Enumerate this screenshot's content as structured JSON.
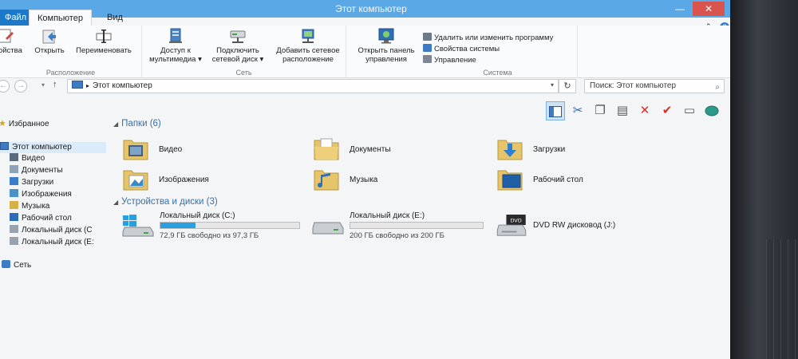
{
  "window": {
    "title": "Этот компьютер"
  },
  "tabs": {
    "file": "Файл",
    "computer": "Компьютер",
    "view": "Вид"
  },
  "ribbon": {
    "location": {
      "label": "Расположение",
      "properties": "Свойства",
      "open": "Открыть",
      "rename": "Переименовать"
    },
    "network": {
      "label": "Сеть",
      "media_access_l1": "Доступ к",
      "media_access_l2": "мультимедиа",
      "map_drive_l1": "Подключить",
      "map_drive_l2": "сетевой диск",
      "add_location_l1": "Добавить сетевое",
      "add_location_l2": "расположение"
    },
    "system": {
      "label": "Система",
      "control_panel_l1": "Открыть панель",
      "control_panel_l2": "управления",
      "uninstall": "Удалить или изменить программу",
      "sys_props": "Свойства системы",
      "manage": "Управление"
    }
  },
  "address": {
    "path": "Этот компьютер",
    "search_placeholder": "Поиск: Этот компьютер"
  },
  "nav": {
    "favorites": "Избранное",
    "this_pc": "Этот компьютер",
    "items": [
      "Видео",
      "Документы",
      "Загрузки",
      "Изображения",
      "Музыка",
      "Рабочий стол",
      "Локальный диск (С",
      "Локальный диск (Е:"
    ],
    "network": "Сеть"
  },
  "folders": {
    "header": "Папки (6)",
    "items": [
      "Видео",
      "Документы",
      "Загрузки",
      "Изображения",
      "Музыка",
      "Рабочий стол"
    ]
  },
  "devices": {
    "header": "Устройства и диски (3)",
    "items": [
      {
        "name": "Локальный диск (C:)",
        "free": "72,9 ГБ свободно из 97,3 ГБ",
        "used_fraction": 0.25
      },
      {
        "name": "Локальный диск (E:)",
        "free": "200 ГБ свободно из 200 ГБ",
        "used_fraction": 0.0
      },
      {
        "name": "DVD RW дисковод (J:)"
      }
    ],
    "dvd_badge": "DVD"
  },
  "colors": {
    "titlebar": "#5aa8e6",
    "file_tab": "#1c79c9",
    "accent": "#3a6ea5",
    "drive_bar": "#2a9fe0",
    "close": "#d9534f"
  }
}
